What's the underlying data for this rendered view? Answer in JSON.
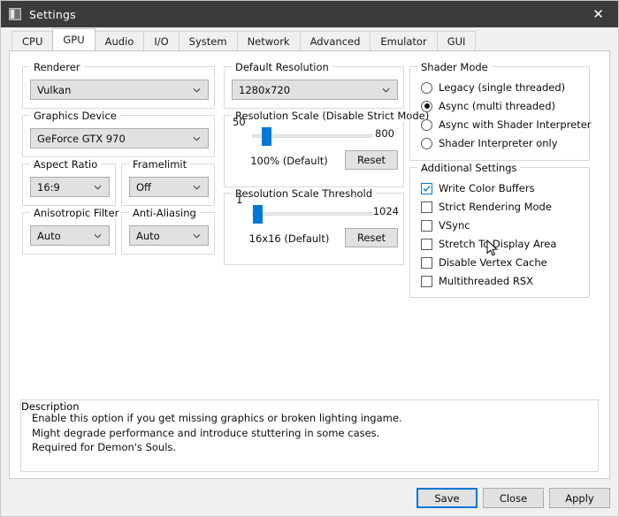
{
  "window": {
    "title": "Settings",
    "icon": "app-icon",
    "close_label": "✕"
  },
  "tabs": [
    {
      "label": "CPU",
      "active": false
    },
    {
      "label": "GPU",
      "active": true
    },
    {
      "label": "Audio",
      "active": false
    },
    {
      "label": "I/O",
      "active": false
    },
    {
      "label": "System",
      "active": false
    },
    {
      "label": "Network",
      "active": false
    },
    {
      "label": "Advanced",
      "active": false
    },
    {
      "label": "Emulator",
      "active": false
    },
    {
      "label": "GUI",
      "active": false
    }
  ],
  "gpu": {
    "renderer": {
      "legend": "Renderer",
      "value": "Vulkan"
    },
    "graphics_device": {
      "legend": "Graphics Device",
      "value": "GeForce GTX 970"
    },
    "aspect_ratio": {
      "legend": "Aspect Ratio",
      "value": "16:9"
    },
    "framelimit": {
      "legend": "Framelimit",
      "value": "Off"
    },
    "anisotropic_filter": {
      "legend": "Anisotropic Filter",
      "value": "Auto"
    },
    "anti_aliasing": {
      "legend": "Anti-Aliasing",
      "value": "Auto"
    },
    "default_resolution": {
      "legend": "Default Resolution",
      "value": "1280x720"
    },
    "resolution_scale": {
      "legend": "Resolution Scale (Disable Strict Mode)",
      "min": "50",
      "max": "800",
      "value_label": "100% (Default)",
      "reset_label": "Reset",
      "handle_percent": 8
    },
    "resolution_scale_threshold": {
      "legend": "Resolution Scale Threshold",
      "min": "1",
      "max": "1024",
      "value_label": "16x16 (Default)",
      "reset_label": "Reset",
      "handle_percent": 1
    },
    "shader_mode": {
      "legend": "Shader Mode",
      "options": [
        {
          "label": "Legacy (single threaded)",
          "checked": false
        },
        {
          "label": "Async (multi threaded)",
          "checked": true
        },
        {
          "label": "Async with Shader Interpreter",
          "checked": false
        },
        {
          "label": "Shader Interpreter only",
          "checked": false
        }
      ]
    },
    "additional_settings": {
      "legend": "Additional Settings",
      "options": [
        {
          "label": "Write Color Buffers",
          "checked": true
        },
        {
          "label": "Strict Rendering Mode",
          "checked": false
        },
        {
          "label": "VSync",
          "checked": false
        },
        {
          "label": "Stretch To Display Area",
          "checked": false
        },
        {
          "label": "Disable Vertex Cache",
          "checked": false
        },
        {
          "label": "Multithreaded RSX",
          "checked": false
        }
      ]
    }
  },
  "description": {
    "legend": "Description",
    "text": "Enable this option if you get missing graphics or broken lighting ingame.\nMight degrade performance and introduce stuttering in some cases.\nRequired for Demon's Souls."
  },
  "footer": {
    "save_label": "Save",
    "close_label": "Close",
    "apply_label": "Apply"
  },
  "colors": {
    "accent": "#0078d7",
    "titlebar": "#3b3b3b",
    "dialog": "#f0f0f0",
    "page": "#ffffff"
  }
}
